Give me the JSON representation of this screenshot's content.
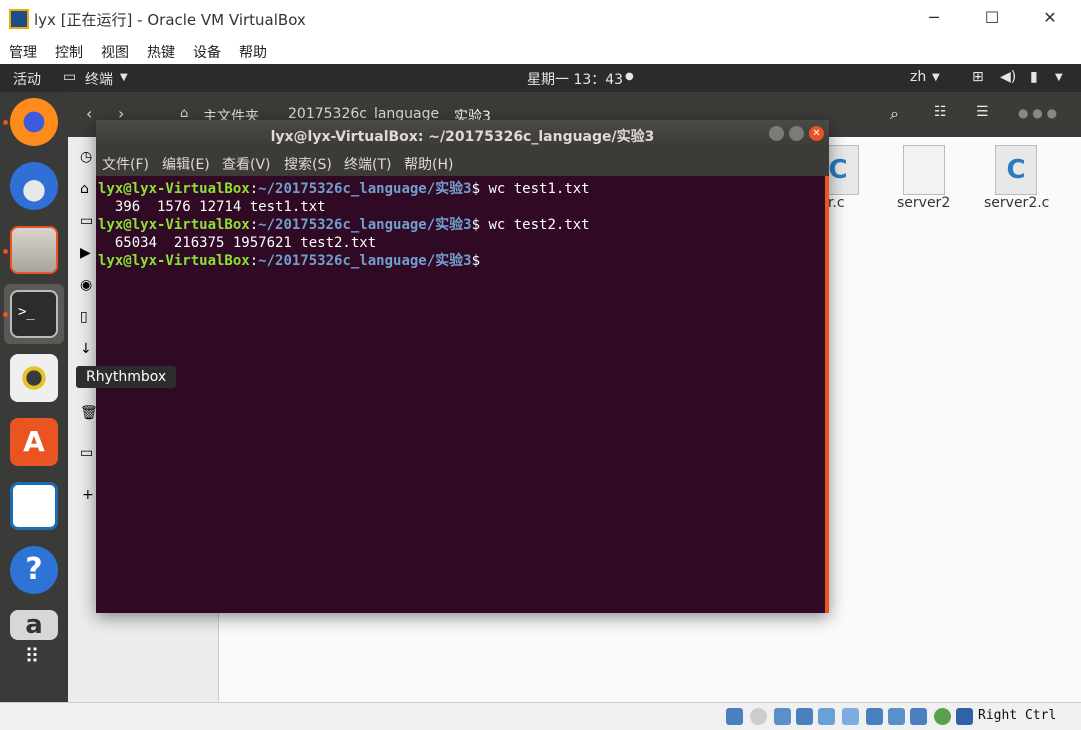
{
  "host": {
    "title": "lyx [正在运行] - Oracle VM VirtualBox",
    "menu": [
      "管理",
      "控制",
      "视图",
      "热键",
      "设备",
      "帮助"
    ],
    "hostkey": "Right Ctrl"
  },
  "topbar": {
    "activities": "活动",
    "app_menu": "终端",
    "clock": "星期一 13：43",
    "lang": "zh"
  },
  "nautilus": {
    "path": [
      "主文件夹",
      "20175326c_language",
      "实验3"
    ],
    "files": [
      "ver.c",
      "server2",
      "server2.c"
    ]
  },
  "terminal": {
    "title": "lyx@lyx-VirtualBox: ~/20175326c_language/实验3",
    "menu": [
      "文件(F)",
      "编辑(E)",
      "查看(V)",
      "搜索(S)",
      "终端(T)",
      "帮助(H)"
    ],
    "prompt_user": "lyx@lyx-VirtualBox",
    "prompt_path": "~/20175326c_language/实验3",
    "lines": [
      {
        "cmd": " wc test1.txt"
      },
      {
        "out": "  396  1576 12714 test1.txt"
      },
      {
        "cmd": " wc test2.txt"
      },
      {
        "out": "  65034  216375 1957621 test2.txt"
      },
      {
        "cmd": ""
      }
    ]
  },
  "tooltip": "Rhythmbox"
}
